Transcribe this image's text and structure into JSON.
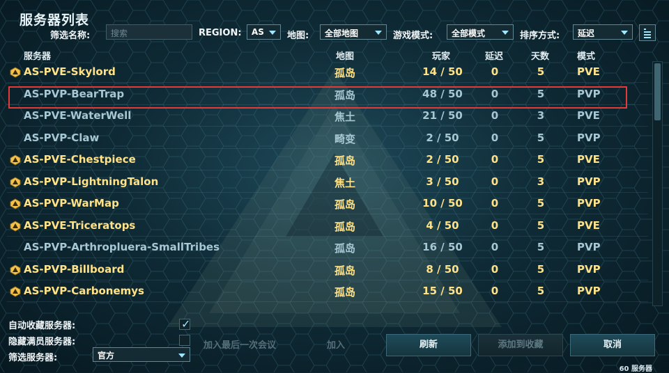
{
  "window": {
    "title": "服务器列表"
  },
  "filters": {
    "name_label": "筛选名称:",
    "search_placeholder": "搜索",
    "region_label": "REGION:",
    "region_value": "AS",
    "map_label": "地图:",
    "map_value": "全部地图",
    "mode_label": "游戏模式:",
    "mode_value": "全部模式",
    "sort_label": "排序方式:",
    "sort_value": "延迟"
  },
  "columns": [
    "服务器",
    "地图",
    "玩家",
    "延迟",
    "天数",
    "模式"
  ],
  "servers": [
    {
      "name": "AS-PVE-Skylord",
      "map": "孤岛",
      "players": "14 / 50",
      "ping": "0",
      "days": "5",
      "mode": "PVE",
      "official": true
    },
    {
      "name": "AS-PVP-BearTrap",
      "map": "孤岛",
      "players": "48 / 50",
      "ping": "0",
      "days": "5",
      "mode": "PVP",
      "official": false
    },
    {
      "name": "AS-PVE-WaterWell",
      "map": "焦土",
      "players": "21 / 50",
      "ping": "0",
      "days": "3",
      "mode": "PVE",
      "official": false
    },
    {
      "name": "AS-PVP-Claw",
      "map": "畸变",
      "players": "2 / 50",
      "ping": "0",
      "days": "5",
      "mode": "PVP",
      "official": false
    },
    {
      "name": "AS-PVE-Chestpiece",
      "map": "孤岛",
      "players": "2 / 50",
      "ping": "0",
      "days": "5",
      "mode": "PVE",
      "official": true
    },
    {
      "name": "AS-PVP-LightningTalon",
      "map": "焦土",
      "players": "3 / 50",
      "ping": "0",
      "days": "3",
      "mode": "PVP",
      "official": true
    },
    {
      "name": "AS-PVP-WarMap",
      "map": "孤岛",
      "players": "10 / 50",
      "ping": "0",
      "days": "5",
      "mode": "PVP",
      "official": true
    },
    {
      "name": "AS-PVE-Triceratops",
      "map": "孤岛",
      "players": "4 / 50",
      "ping": "0",
      "days": "5",
      "mode": "PVE",
      "official": true
    },
    {
      "name": "AS-PVP-Arthropluera-SmallTribes",
      "map": "孤岛",
      "players": "16 / 50",
      "ping": "0",
      "days": "5",
      "mode": "PVP",
      "official": false
    },
    {
      "name": "AS-PVP-Billboard",
      "map": "孤岛",
      "players": "8 / 50",
      "ping": "0",
      "days": "5",
      "mode": "PVP",
      "official": true
    },
    {
      "name": "AS-PVP-Carbonemys",
      "map": "孤岛",
      "players": "15 / 50",
      "ping": "0",
      "days": "5",
      "mode": "PVP",
      "official": true
    }
  ],
  "bottom": {
    "auto_favorite_label": "自动收藏服务器:",
    "auto_favorite_checked": true,
    "hide_full_label": "隐藏满员服务器:",
    "hide_full_checked": false,
    "server_filter_label": "筛选服务器:",
    "server_filter_value": "官方",
    "join_last_session": "加入最后一次会议",
    "join": "加入",
    "refresh": "刷新",
    "add_favorite": "添加到收藏",
    "cancel": "取消",
    "server_count": "60 服务器"
  },
  "colors": {
    "official_text": "#ffe287",
    "unofficial_text": "#a6c7d3",
    "highlight_border": "#e33a3a",
    "accent": "#9fe6ff"
  }
}
